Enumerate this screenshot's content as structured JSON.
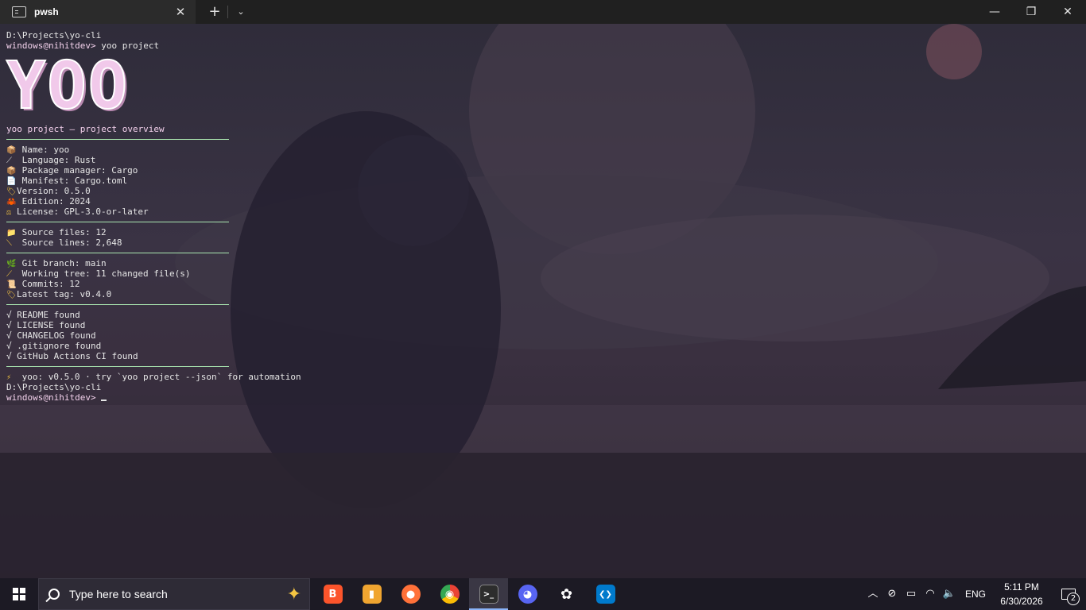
{
  "window": {
    "tab_title": "pwsh",
    "tab_close": "✕",
    "new_tab": "+",
    "dropdown": "⌄",
    "minimize": "—",
    "maximize": "❐",
    "close": "✕"
  },
  "terminal": {
    "path1": "D:\\Projects\\yo-cli",
    "prompt1": "windows@nihitdev> ",
    "command": "yoo project",
    "logo": "YOO",
    "subtitle": "yoo project — project overview",
    "meta": [
      {
        "icon": "📦",
        "text": "Name: yoo"
      },
      {
        "icon": "⟋",
        "text": "Language: Rust"
      },
      {
        "icon": "📦",
        "text": "Package manager: Cargo"
      },
      {
        "icon": "📄",
        "text": "Manifest: Cargo.toml"
      },
      {
        "icon": "🏷",
        "text": "Version: 0.5.0"
      },
      {
        "icon": "🦀",
        "text": "Edition: 2024"
      },
      {
        "icon": "⚖",
        "text": "License: GPL-3.0-or-later"
      }
    ],
    "source": [
      {
        "icon": "📁",
        "text": "Source files: 12"
      },
      {
        "icon": "⟍",
        "text": "Source lines: 2,648"
      }
    ],
    "git": [
      {
        "icon": "🌿",
        "text": "Git branch: main"
      },
      {
        "icon": "⟋",
        "text": "Working tree: 11 changed file(s)"
      },
      {
        "icon": "📜",
        "text": "Commits: 12"
      },
      {
        "icon": "🏷",
        "text": "Latest tag: v0.4.0"
      }
    ],
    "checks": [
      "√ README found",
      "√ LICENSE found",
      "√ CHANGELOG found",
      "√ .gitignore found",
      "√ GitHub Actions CI found"
    ],
    "footer_icon": "⚡",
    "footer": "yoo: v0.5.0 · try `yoo project --json` for automation",
    "path2": "D:\\Projects\\yo-cli",
    "prompt2": "windows@nihitdev> "
  },
  "taskbar": {
    "search_placeholder": "Type here to search",
    "apps": [
      {
        "name": "brave",
        "label": "B",
        "color": "#fb542b",
        "active": false
      },
      {
        "name": "files",
        "label": "▮",
        "color": "#f0a530",
        "active": false
      },
      {
        "name": "firefox",
        "label": "●",
        "color": "#ff7139",
        "active": false
      },
      {
        "name": "chrome",
        "label": "◉",
        "color": "#34a853",
        "active": false
      },
      {
        "name": "terminal",
        "label": ">_",
        "color": "#2d2d2d",
        "active": true
      },
      {
        "name": "discord",
        "label": "◕",
        "color": "#5865f2",
        "active": false
      },
      {
        "name": "chatgpt",
        "label": "✿",
        "color": "#1c1a24",
        "active": false
      },
      {
        "name": "vscode",
        "label": "❮❯",
        "color": "#007acc",
        "active": false
      }
    ],
    "language": "ENG",
    "time": "5:11 PM",
    "date": "6/30/2026",
    "notifications": "2"
  }
}
